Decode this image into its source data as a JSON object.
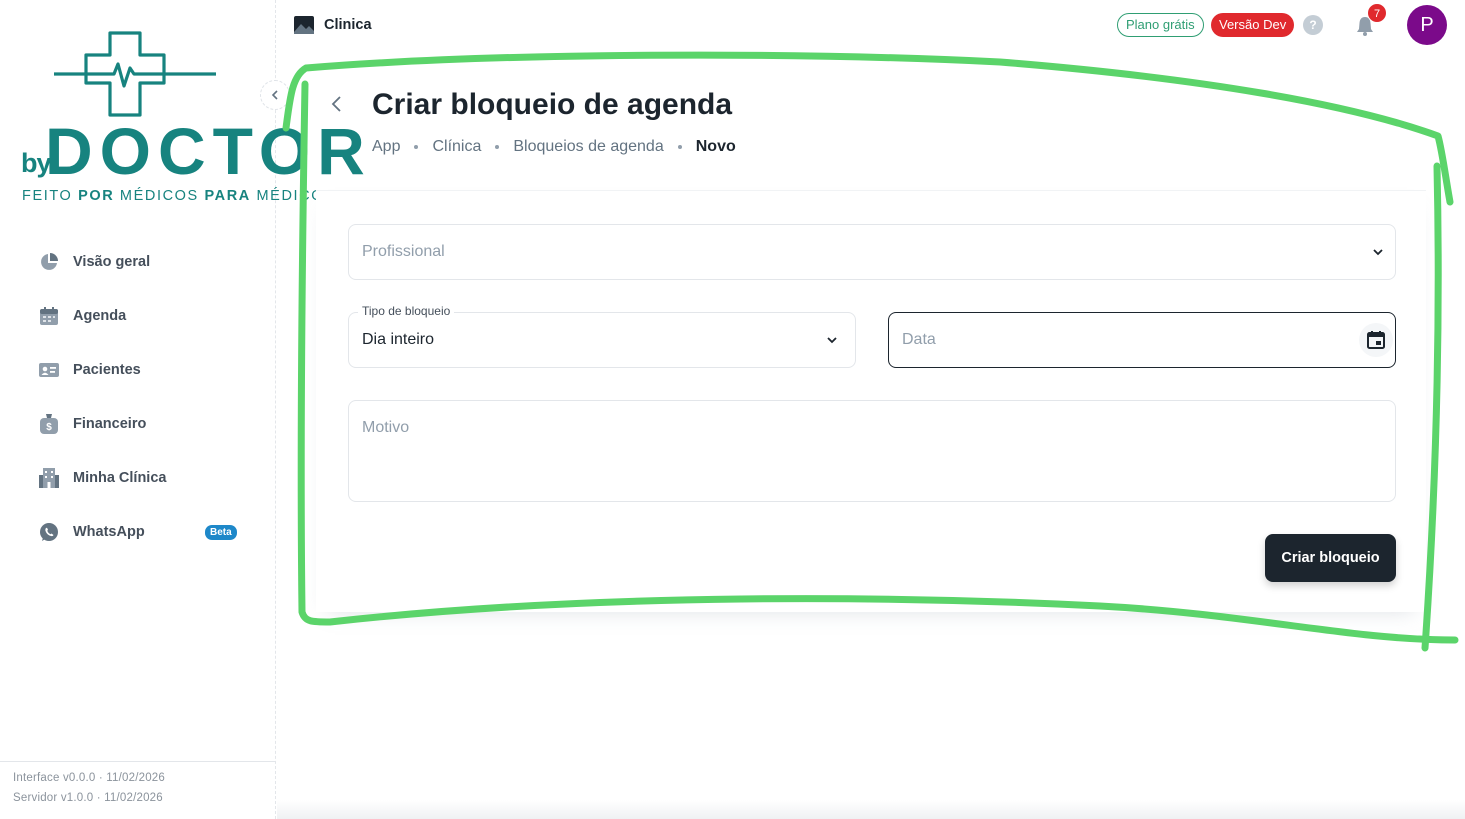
{
  "logo": {
    "by": "by",
    "name": "DOCTOR",
    "tagline_pre": "FEITO ",
    "tagline_bold": "POR",
    "tagline_post": " MÉDICOS ",
    "tagline_bold2": "PARA",
    "tagline_end": " MÉDICOS",
    "color": "#17837f"
  },
  "sidebar": {
    "items": [
      {
        "label": "Visão geral",
        "icon": "pie-chart-icon"
      },
      {
        "label": "Agenda",
        "icon": "calendar-icon"
      },
      {
        "label": "Pacientes",
        "icon": "id-card-icon"
      },
      {
        "label": "Financeiro",
        "icon": "money-bag-icon"
      },
      {
        "label": "Minha Clínica",
        "icon": "building-icon"
      },
      {
        "label": "WhatsApp",
        "icon": "whatsapp-icon",
        "badge": "Beta"
      }
    ],
    "footer": {
      "interface": "Interface v0.0.0 · 11/02/2026",
      "server": "Servidor v1.0.0 · 11/02/2026"
    }
  },
  "header": {
    "clinic_name": "Clinica",
    "plan_chip": "Plano grátis",
    "dev_chip": "Versão Dev",
    "help": "?",
    "notifications_count": "7",
    "avatar_letter": "P"
  },
  "page": {
    "title": "Criar bloqueio de agenda",
    "breadcrumb": [
      "App",
      "Clínica",
      "Bloqueios de agenda",
      "Novo"
    ]
  },
  "form": {
    "professional_placeholder": "Profissional",
    "block_type_label": "Tipo de bloqueio",
    "block_type_value": "Dia inteiro",
    "date_placeholder": "Data",
    "reason_placeholder": "Motivo",
    "submit_label": "Criar bloqueio"
  },
  "colors": {
    "accent": "#1c252e",
    "annotation": "#5bd46a",
    "danger": "#e0292d",
    "success": "#2f9e73",
    "avatar": "#7b0a8a",
    "beta": "#1e88c9"
  }
}
